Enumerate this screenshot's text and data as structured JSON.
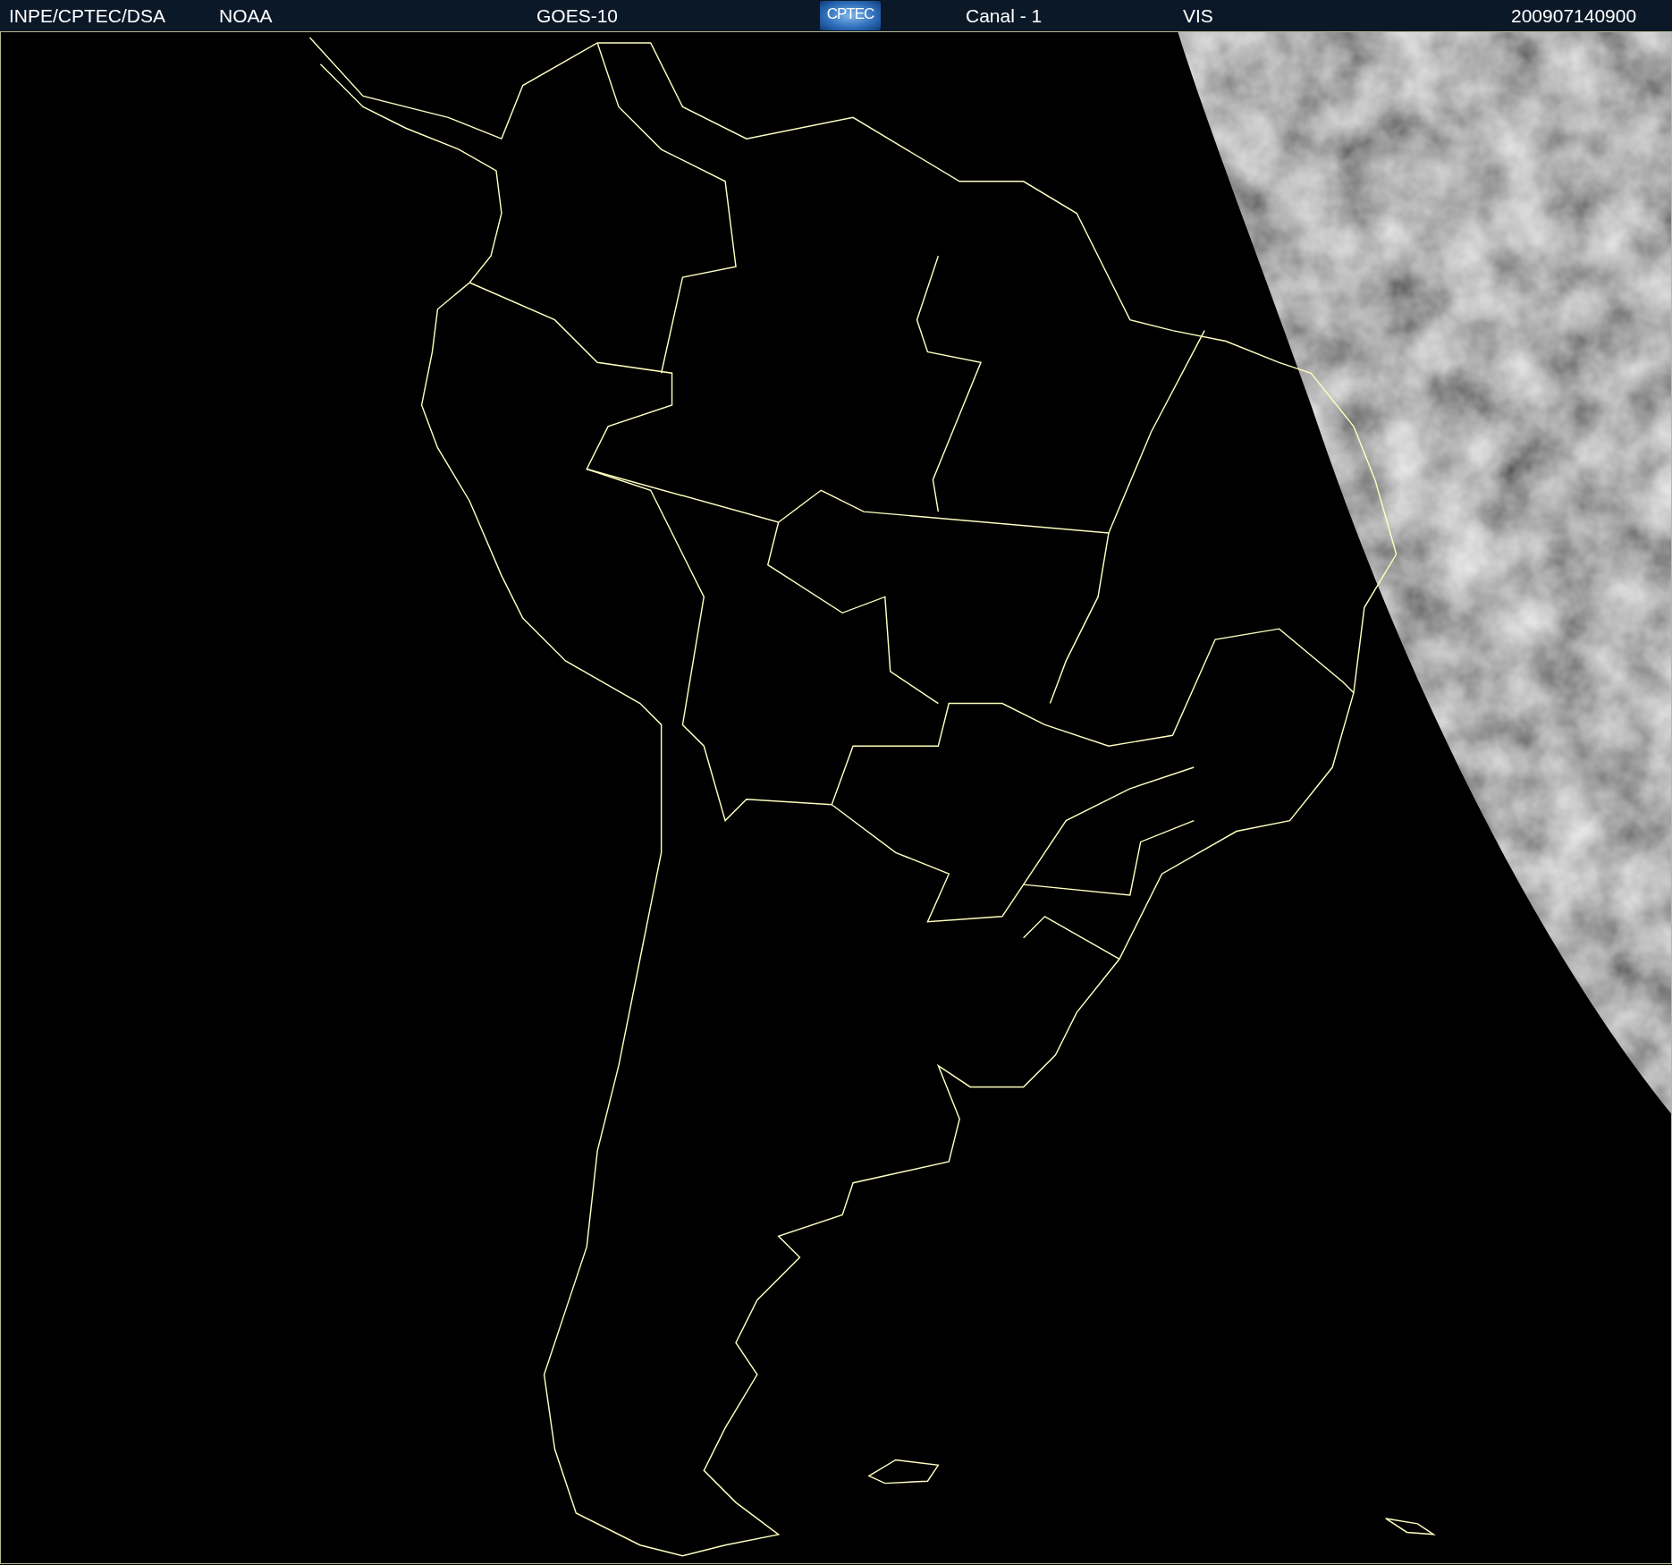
{
  "header_items": [
    {
      "kind": "text",
      "text": "INPE/CPTEC/DSA"
    },
    {
      "kind": "text",
      "text": "NOAA"
    },
    {
      "kind": "text",
      "text": "GOES-10"
    },
    {
      "kind": "logo",
      "text": "CPTEC"
    },
    {
      "kind": "text",
      "text": "Canal - 1"
    },
    {
      "kind": "text",
      "text": "VIS"
    },
    {
      "kind": "text",
      "text": "200907140900"
    }
  ]
}
